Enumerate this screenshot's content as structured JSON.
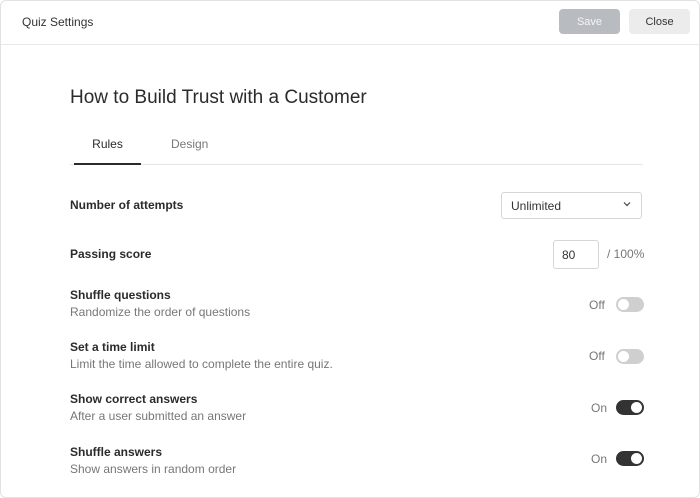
{
  "header": {
    "title": "Quiz Settings",
    "save_label": "Save",
    "close_label": "Close"
  },
  "page": {
    "title": "How to Build Trust with a Customer"
  },
  "tabs": [
    {
      "label": "Rules"
    },
    {
      "label": "Design"
    }
  ],
  "settings": {
    "attempts": {
      "label": "Number of attempts",
      "value": "Unlimited"
    },
    "passing_score": {
      "label": "Passing score",
      "value": "80",
      "suffix": "/ 100%"
    },
    "shuffle_questions": {
      "label": "Shuffle questions",
      "description": "Randomize the order of questions",
      "state": "Off"
    },
    "time_limit": {
      "label": "Set a time limit",
      "description": "Limit the time allowed to complete the entire quiz.",
      "state": "Off"
    },
    "correct_answers": {
      "label": "Show correct answers",
      "description": "After a user submitted an answer",
      "state": "On"
    },
    "shuffle_answers": {
      "label": "Shuffle answers",
      "description": "Show answers in random order",
      "state": "On"
    }
  },
  "icons": {
    "dropdown": "chevron-down-icon"
  },
  "colors": {
    "toggle_on": "#333333",
    "toggle_off": "#cfcfcf",
    "save_disabled": "#b8bcc0"
  }
}
